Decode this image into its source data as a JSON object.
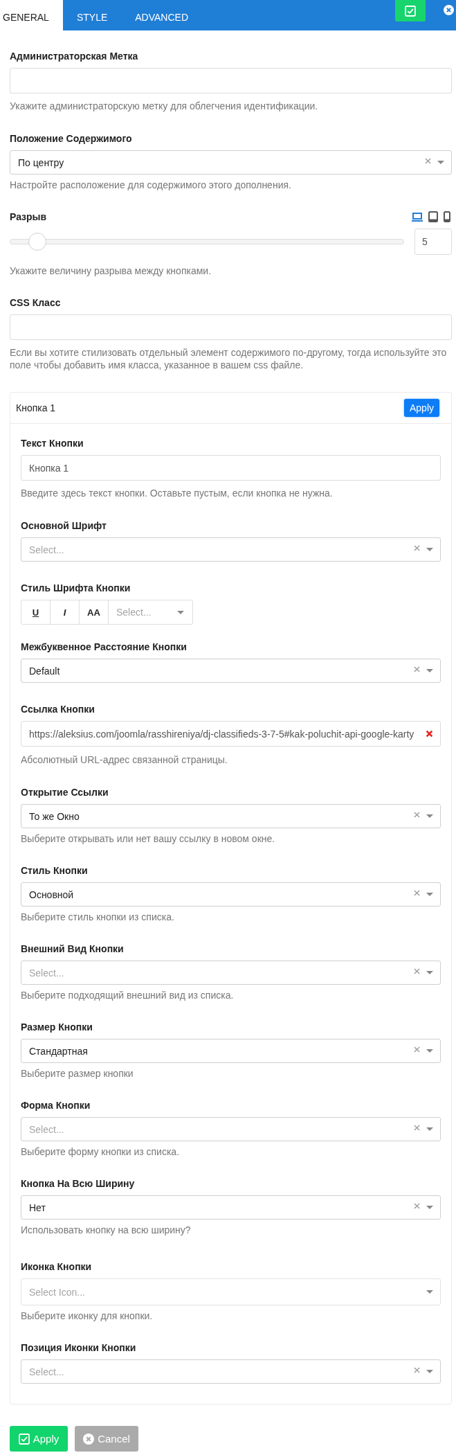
{
  "tabs": [
    {
      "label": "GENERAL",
      "selected": true
    },
    {
      "label": "STYLE",
      "selected": false
    },
    {
      "label": "ADVANCED",
      "selected": false
    }
  ],
  "fields": [
    {
      "kind": "text",
      "label": "Администраторская Метка",
      "help": "Укажите администраторскую метку для облегчения идентификации."
    },
    {
      "kind": "select",
      "label": "Положение Содержимого",
      "value": "По центру",
      "help": "Настройте расположение для содержимого этого дополнения."
    },
    {
      "kind": "slider",
      "label": "Разрыв",
      "devices": [
        {
          "kind": "desktop",
          "selected": true
        },
        {
          "kind": "tablet",
          "selected": false
        },
        {
          "kind": "mobile",
          "selected": false
        }
      ],
      "level": 0.05,
      "value": "5",
      "help": "Укажите величину разрыва между кнопками."
    },
    {
      "kind": "text",
      "label": "CSS Класс",
      "help": "Если вы хотите стилизовать отдельный элемент содержимого по-другому, тогда используйте это поле чтобы добавить имя класса, указанное в вашем css файле."
    }
  ],
  "panel": {
    "title": "Кнопка 1",
    "apply": "Apply",
    "fields": [
      {
        "kind": "text",
        "label": "Текст Кнопки",
        "value": "Кнопка 1",
        "help": "Введите здесь текст кнопки. Оставьте пустым, если кнопка не нужна."
      },
      {
        "kind": "select",
        "label": "Основной Шрифт",
        "placeholder": "Select..."
      },
      {
        "kind": "font_style",
        "label": "Стиль Шрифта Кнопки",
        "toggles": [
          {
            "kind": "underline",
            "label": "U"
          },
          {
            "kind": "italic",
            "label": "I"
          },
          {
            "kind": "uppercase",
            "label": "AA"
          }
        ],
        "placeholder": "Select..."
      },
      {
        "kind": "select",
        "label": "Межбуквенное Расстояние Кнопки",
        "value": "Default"
      },
      {
        "kind": "link",
        "label": "Ссылка Кнопки",
        "value": "https://aleksius.com/joomla/rasshireniya/dj-classifieds-3-7-5#kak-poluchit-api-google-karty",
        "help": "Абсолютный URL-адрес связанной страницы."
      },
      {
        "kind": "select",
        "label": "Открытие Ссылки",
        "value": "То же Окно",
        "help": "Выберите открывать или нет вашу ссылку в новом окне."
      },
      {
        "kind": "select",
        "label": "Стиль Кнопки",
        "value": "Основной",
        "help": "Выберите стиль кнопки из списка."
      },
      {
        "kind": "select",
        "label": "Внешний Вид Кнопки",
        "placeholder": "Select...",
        "help": "Выберите подходящий внешний вид из списка."
      },
      {
        "kind": "select",
        "label": "Размер Кнопки",
        "value": "Стандартная",
        "help": "Выберите размер кнопки"
      },
      {
        "kind": "select",
        "label": "Форма Кнопки",
        "placeholder": "Select...",
        "help": "Выберите форму кнопки из списка."
      },
      {
        "kind": "select",
        "label": "Кнопка На Всю Ширину",
        "value": "Нет",
        "help": "Использовать кнопку на всю ширину?"
      },
      {
        "kind": "icon_select",
        "label": "Иконка Кнопки",
        "placeholder": "Select Icon...",
        "help": "Выберите иконку для кнопки."
      },
      {
        "kind": "select",
        "label": "Позиция Иконки Кнопки",
        "placeholder": "Select..."
      }
    ]
  },
  "footer": {
    "apply": "Apply",
    "cancel": "Cancel"
  }
}
